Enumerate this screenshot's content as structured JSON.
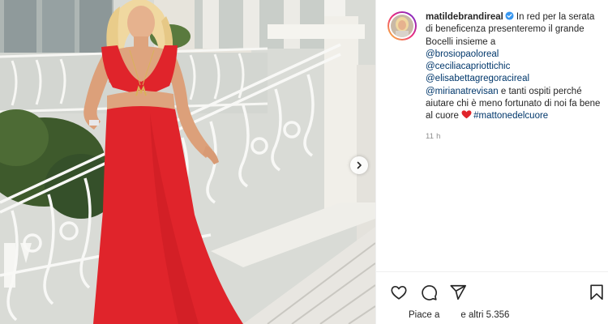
{
  "post": {
    "username": "matildebrandireal",
    "caption_intro": "In red per la serata di beneficenza presenteremo il grande Bocelli insieme a",
    "mentions": [
      "@brosiopaoloreal",
      "@ceciliacapriottichic",
      "@elisabettagregoracireal",
      "@mirianatrevisan"
    ],
    "caption_middle": "e tanti ospiti perché aiutare chi è meno fortunato di noi fa bene al cuore",
    "hashtag": "#mattonedelcuore",
    "time_ago": "11 h",
    "likes_prefix": "Piace a",
    "likes_suffix": "e altri 5.356"
  },
  "icons": {
    "verified": "verified-badge-icon",
    "heart_emoji": "red-heart-emoji",
    "like": "heart-outline-icon",
    "comment": "speech-bubble-icon",
    "share": "paper-plane-icon",
    "save": "bookmark-icon",
    "next": "chevron-right-icon"
  },
  "colors": {
    "link": "#00376b",
    "text": "#262626",
    "muted": "#8e8e8e",
    "verified": "#3897f0",
    "dress": "#e0242b"
  }
}
